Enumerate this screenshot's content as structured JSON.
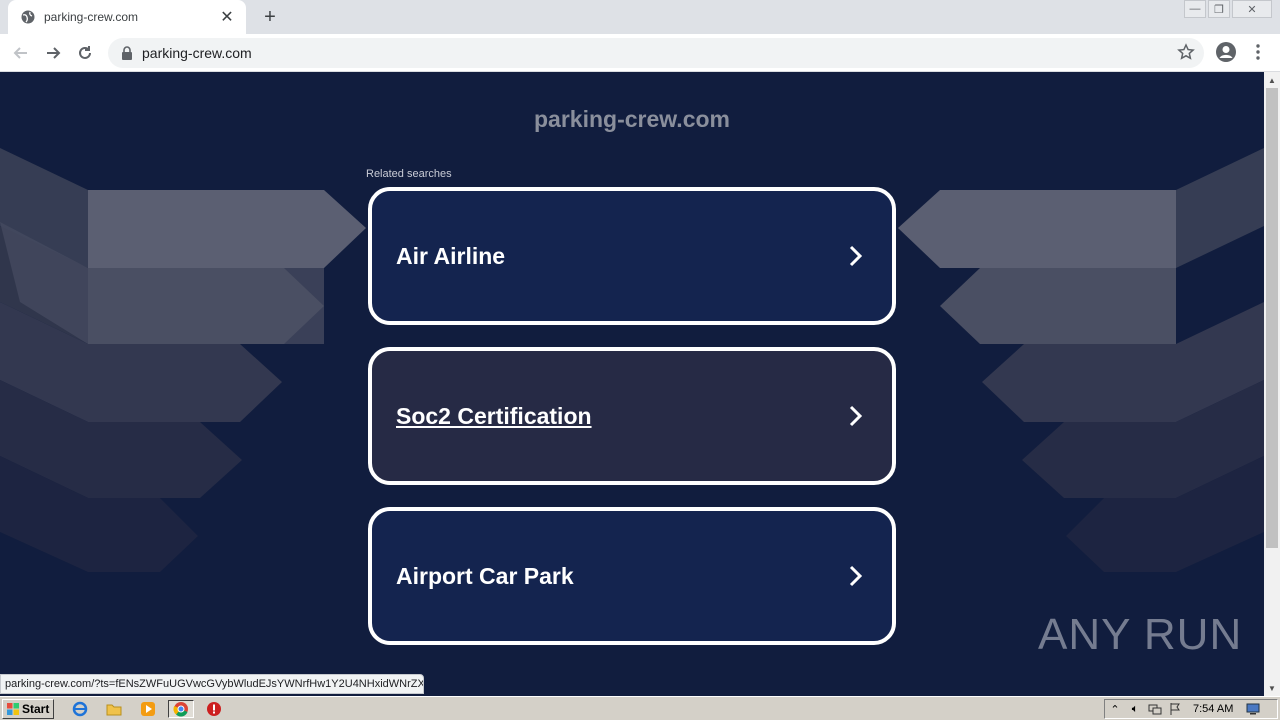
{
  "browser": {
    "tab_title": "parking-crew.com",
    "url": "parking-crew.com",
    "status_url": "parking-crew.com/?ts=fENsZWFuUGVwcGVybWludEJsYWNrfHw1Y2U4NHxidWNrZXQ..."
  },
  "page": {
    "site_title": "parking-crew.com",
    "related_label": "Related searches",
    "cards": [
      {
        "label": "Air Airline"
      },
      {
        "label": "Soc2 Certification"
      },
      {
        "label": "Airport Car Park"
      }
    ],
    "watermark": "ANY RUN"
  },
  "taskbar": {
    "start_label": "Start",
    "clock": "7:54 AM"
  },
  "colors": {
    "page_bg": "#111d3e",
    "card_bg": "#14244f",
    "card_hover_bg": "#262a45",
    "card_border": "#ffffff",
    "title_gray": "#8a8f9c"
  }
}
